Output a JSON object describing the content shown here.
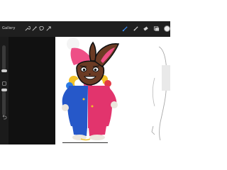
{
  "toolbar": {
    "gallery_label": "Gallery",
    "left_tools": [
      "wrench-icon",
      "magic-wand-icon",
      "selection-icon",
      "transform-arrow-icon"
    ],
    "right_tools": [
      "brush-icon",
      "smudge-icon",
      "eraser-icon",
      "layers-icon",
      "color-swatch"
    ],
    "active_tool": "brush-icon",
    "accent_color": "#3a8df3",
    "current_color": "#ececec"
  },
  "sidebar": {
    "controls": [
      "brush-size-slider",
      "modify-square-button",
      "brush-opacity-slider",
      "undo-icon"
    ]
  }
}
